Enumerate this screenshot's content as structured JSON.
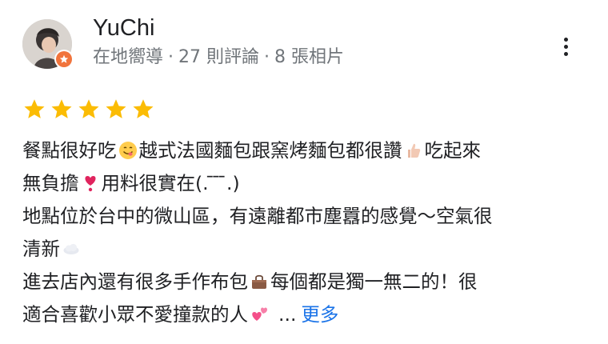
{
  "review": {
    "author": {
      "name": "YuChi",
      "badge_icon": "local-guide-icon",
      "meta_role": "在地嚮導",
      "meta_reviews": "27 則評論",
      "meta_photos": "8 張相片",
      "meta_separator": "·"
    },
    "rating": {
      "stars": 5,
      "max": 5,
      "color": "#fbbc04"
    },
    "more_options_icon": "more-vert-icon",
    "text": {
      "l1a": "餐點很好吃",
      "e1": "savoring-face-emoji",
      "l1b": "越式法國麵包跟窯烤麵包都很讚",
      "e2": "thumbs-up-emoji",
      "l1c": "吃起來",
      "l2a": "無負擔",
      "e3": "heart-exclamation-emoji",
      "l2b": "用料很實在(. ̄ ̄ ̄.)",
      "l3": "地點位於台中的微山區，有遠離都市塵囂的感覺～空氣很",
      "l4a": "清新",
      "e4": "cloud-emoji",
      "l5a": "進去店內還有很多手作布包",
      "e5": "handbag-emoji",
      "l5b": "每個都是獨一無二的！很",
      "l6a": "適合喜歡小眾不愛撞款的人",
      "e6": "two-hearts-emoji",
      "ellipsis": "...",
      "more_label": "更多"
    },
    "colors": {
      "link": "#1a73e8",
      "meta": "#70757a",
      "badge": "#f1743c"
    }
  }
}
